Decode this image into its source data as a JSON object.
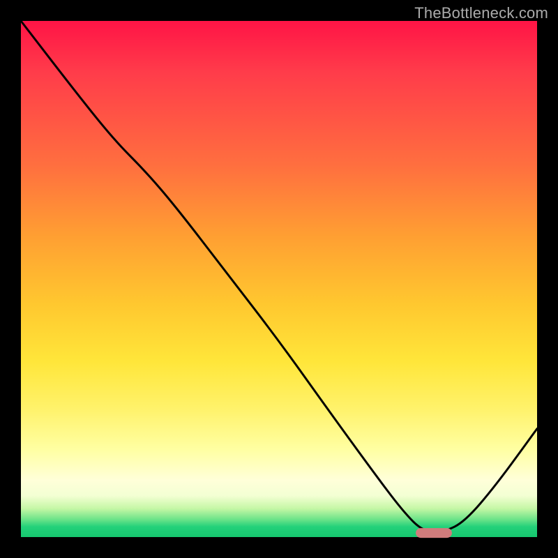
{
  "watermark": "TheBottleneck.com",
  "chart_data": {
    "type": "line",
    "title": "",
    "xlabel": "",
    "ylabel": "",
    "xlim": [
      0,
      1
    ],
    "ylim": [
      0,
      1
    ],
    "grid": false,
    "zone_colors": {
      "worst_top": "#ff1446",
      "mid": "#ffe63a",
      "best_bottom": "#16c86f"
    },
    "series": [
      {
        "name": "bottleneck-curve",
        "color": "#000000",
        "x": [
          0.0,
          0.1,
          0.18,
          0.24,
          0.3,
          0.4,
          0.5,
          0.6,
          0.68,
          0.74,
          0.78,
          0.82,
          0.86,
          0.92,
          1.0
        ],
        "y": [
          1.0,
          0.87,
          0.77,
          0.71,
          0.64,
          0.51,
          0.38,
          0.24,
          0.13,
          0.05,
          0.01,
          0.01,
          0.03,
          0.1,
          0.21
        ]
      }
    ],
    "marker": {
      "name": "optimal-range",
      "shape": "pill",
      "color": "#d07c7c",
      "x_start": 0.765,
      "x_end": 0.835,
      "y": 0.008
    }
  }
}
